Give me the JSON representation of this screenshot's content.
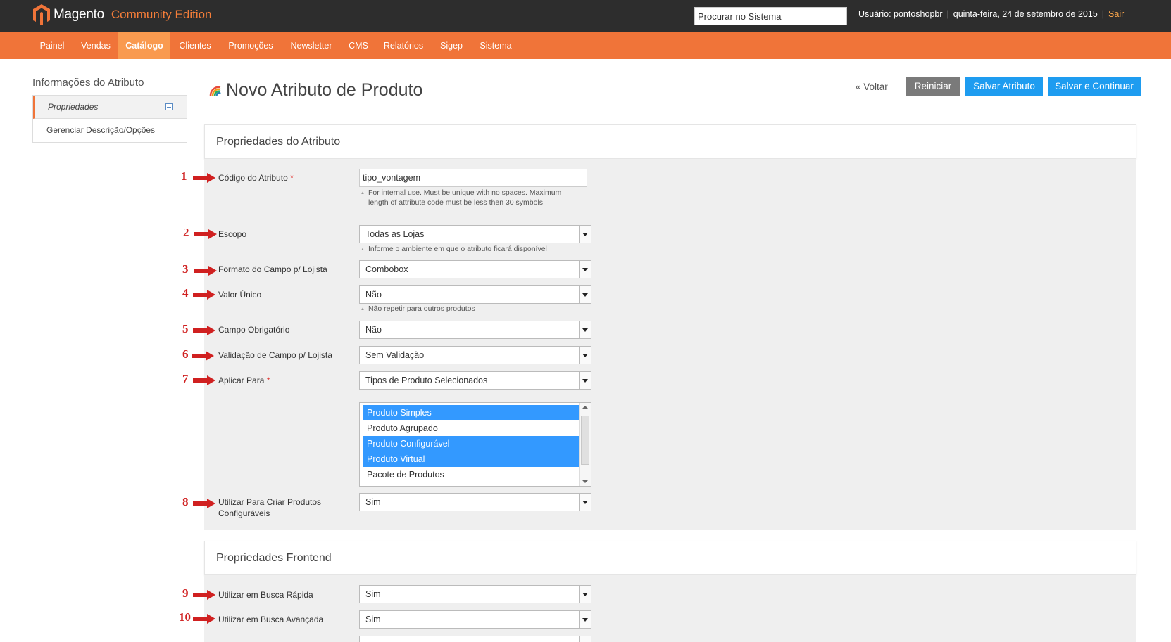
{
  "header": {
    "logo_text": "Magento",
    "edition": "Community Edition",
    "search_value": "Procurar no Sistema",
    "user": "Usuário: pontoshopbr",
    "date": "quinta-feira, 24 de setembro de 2015",
    "separator": "|",
    "logout": "Sair"
  },
  "nav": {
    "items": [
      "Painel",
      "Vendas",
      "Catálogo",
      "Clientes",
      "Promoções",
      "Newsletter",
      "CMS",
      "Relatórios",
      "Sigep",
      "Sistema"
    ],
    "active": "Catálogo"
  },
  "sidebar": {
    "title": "Informações do Atributo",
    "tabs": [
      "Propriedades",
      "Gerenciar Descrição/Opções"
    ]
  },
  "page": {
    "title": "Novo Atributo de Produto",
    "back": "« Voltar",
    "reset": "Reiniciar",
    "save": "Salvar Atributo",
    "save_continue": "Salvar e Continuar"
  },
  "sections": {
    "attribute": "Propriedades do Atributo",
    "frontend": "Propriedades Frontend"
  },
  "form": {
    "required_mark": "*",
    "code": {
      "num": "1",
      "label": "Código do Atributo",
      "value": "tipo_vontagem",
      "note": "For internal use. Must be unique with no spaces. Maximum length of attribute code must be less then 30 symbols"
    },
    "scope": {
      "num": "2",
      "label": "Escopo",
      "value": "Todas as Lojas",
      "note": "Informe o ambiente em que o atributo ficará disponível"
    },
    "input_type": {
      "num": "3",
      "label": "Formato do Campo p/ Lojista",
      "value": "Combobox"
    },
    "unique": {
      "num": "4",
      "label": "Valor Único",
      "value": "Não",
      "note": "Não repetir para outros produtos"
    },
    "required": {
      "num": "5",
      "label": "Campo Obrigatório",
      "value": "Não"
    },
    "validation": {
      "num": "6",
      "label": "Validação de Campo p/ Lojista",
      "value": "Sem Validação"
    },
    "apply_to": {
      "num": "7",
      "label": "Aplicar Para",
      "value": "Tipos de Produto Selecionados",
      "options": [
        "Produto Simples",
        "Produto Agrupado",
        "Produto Configurável",
        "Produto Virtual",
        "Pacote de Produtos"
      ]
    },
    "configurable": {
      "num": "8",
      "label": "Utilizar Para Criar Produtos Configuráveis",
      "value": "Sim"
    },
    "quick_search": {
      "num": "9",
      "label": "Utilizar em Busca Rápida",
      "value": "Sim"
    },
    "advanced_search": {
      "num": "10",
      "label": "Utilizar em Busca Avançada",
      "value": "Sim"
    }
  },
  "colors": {
    "header_bg": "#2d2d2d",
    "nav_bg": "#f07439",
    "nav_active": "#f99a4f",
    "primary_button": "#1e9cf0",
    "secondary_button": "#7a7a7a",
    "annotation_red": "#d02020",
    "selected_option": "#3399ff"
  }
}
